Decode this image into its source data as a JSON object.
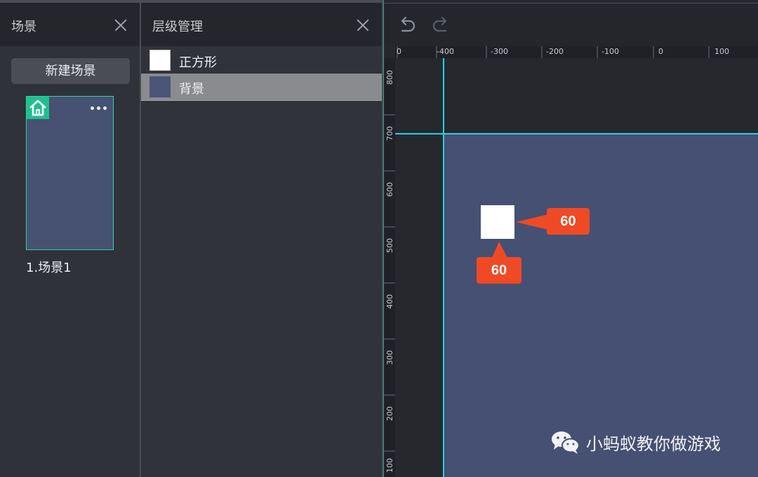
{
  "scene_panel": {
    "title": "场景",
    "new_scene_label": "新建场景",
    "scenes": [
      {
        "label": "1.场景1"
      }
    ]
  },
  "layer_panel": {
    "title": "层级管理",
    "layers": [
      {
        "name": "正方形",
        "swatch_color": "#ffffff",
        "selected": false
      },
      {
        "name": "背景",
        "swatch_color": "#4a5577",
        "selected": true
      }
    ]
  },
  "canvas": {
    "ruler_top_labels": [
      "0",
      "-400",
      "-300",
      "-200",
      "-100",
      "0",
      "100"
    ],
    "ruler_left_labels": [
      "800",
      "700",
      "600",
      "500",
      "400",
      "300",
      "200",
      "100"
    ],
    "width_label": "60",
    "height_label": "60",
    "stage_color": "#465073",
    "guide_color": "#27d2e2",
    "tag_color": "#ef4a25"
  },
  "watermark": {
    "icon": "wechat-icon",
    "text": "小蚂蚁教你做游戏"
  }
}
